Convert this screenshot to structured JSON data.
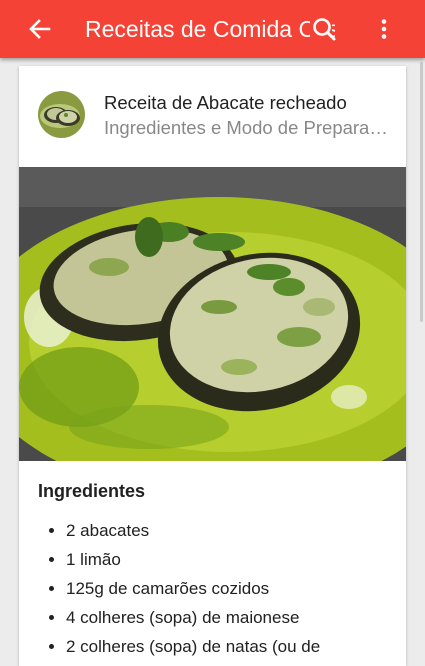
{
  "appbar": {
    "title": "Receitas de Comida Cas",
    "back_icon": "arrow-left-icon",
    "search_icon": "search-icon",
    "menu_icon": "more-vertical-icon",
    "color": "#f44336"
  },
  "recipe": {
    "title": "Receita de Abacate recheado",
    "subtitle": "Ingredientes e Modo de Preparação",
    "section_title": "Ingredientes",
    "ingredients": [
      "2 abacates",
      "1 limão",
      "125g de camarões cozidos",
      "4 colheres (sopa) de maionese",
      "2 colheres (sopa) de natas (ou de"
    ]
  }
}
